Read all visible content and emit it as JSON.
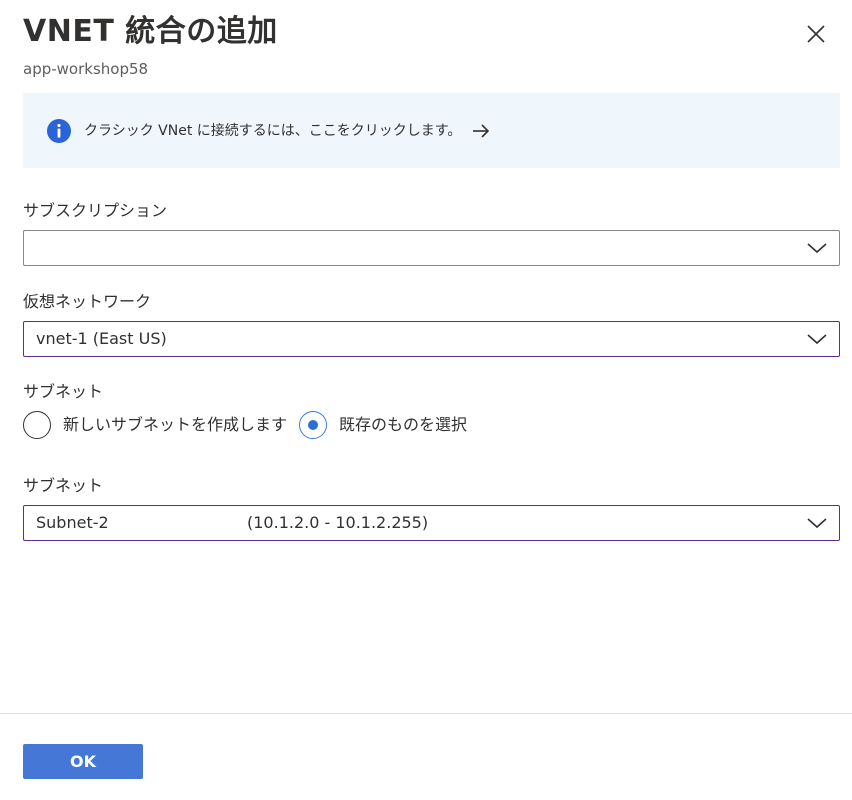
{
  "header": {
    "title": "VNET 統合の追加",
    "subtitle": "app-workshop58",
    "close_icon": "close-icon"
  },
  "info_banner": {
    "icon": "info-icon",
    "text": "クラシック VNet に接続するには、ここをクリックします。",
    "arrow_icon": "arrow-right-icon",
    "icon_color": "#2b64d6"
  },
  "subscription": {
    "label": "サブスクリプション",
    "value": ""
  },
  "virtual_network": {
    "label": "仮想ネットワーク",
    "value": "vnet-1 (East US)"
  },
  "subnet_mode": {
    "label": "サブネット",
    "options": [
      {
        "label": "新しいサブネットを作成します",
        "checked": false
      },
      {
        "label": "既存のものを選択",
        "checked": true
      }
    ]
  },
  "subnet": {
    "label": "サブネット",
    "name": "Subnet-2",
    "range": "(10.1.2.0 - 10.1.2.255)"
  },
  "footer": {
    "ok_label": "OK",
    "ok_color": "#4578d6"
  },
  "colors": {
    "focus_border": "#5c2e91",
    "info_background": "#eff6fc",
    "radio_checked": "#2a6fd6"
  }
}
